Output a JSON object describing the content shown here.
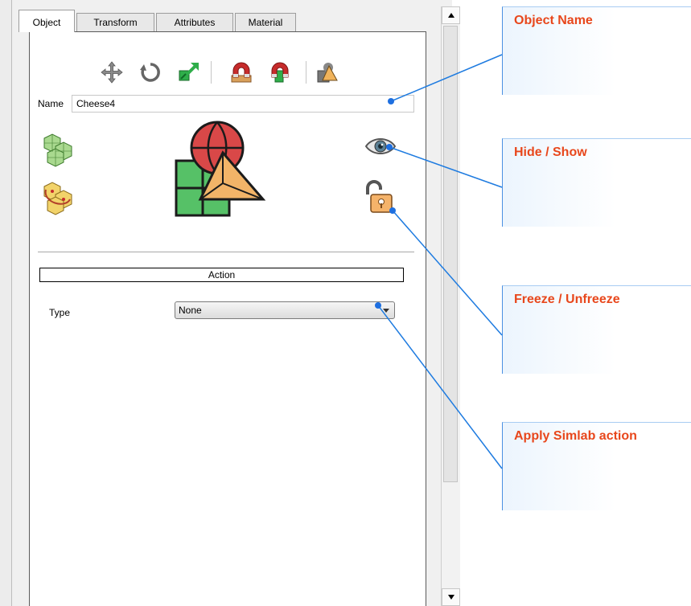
{
  "tabs": [
    {
      "label": "Object",
      "active": true
    },
    {
      "label": "Transform",
      "active": false
    },
    {
      "label": "Attributes",
      "active": false
    },
    {
      "label": "Material",
      "active": false
    }
  ],
  "toolbar": {
    "icons": [
      "move-icon",
      "rotate-icon",
      "scale-icon",
      "snap-magnet-icon",
      "snap-magnet-alt-icon",
      "pivot-icon"
    ]
  },
  "name_field": {
    "label": "Name",
    "value": "Cheese4"
  },
  "object_icons": [
    "mesh-group-icon",
    "mesh-linked-icon",
    "object-preview-icon",
    "eye-icon",
    "unlock-icon"
  ],
  "action": {
    "header": "Action",
    "type_label": "Type",
    "type_value": "None"
  },
  "callouts": [
    {
      "label": "Object Name"
    },
    {
      "label": "Hide / Show"
    },
    {
      "label": "Freeze / Unfreeze"
    },
    {
      "label": "Apply Simlab action"
    }
  ],
  "colors": {
    "callout_text": "#e8471c",
    "callout_line": "#1e7be0"
  }
}
